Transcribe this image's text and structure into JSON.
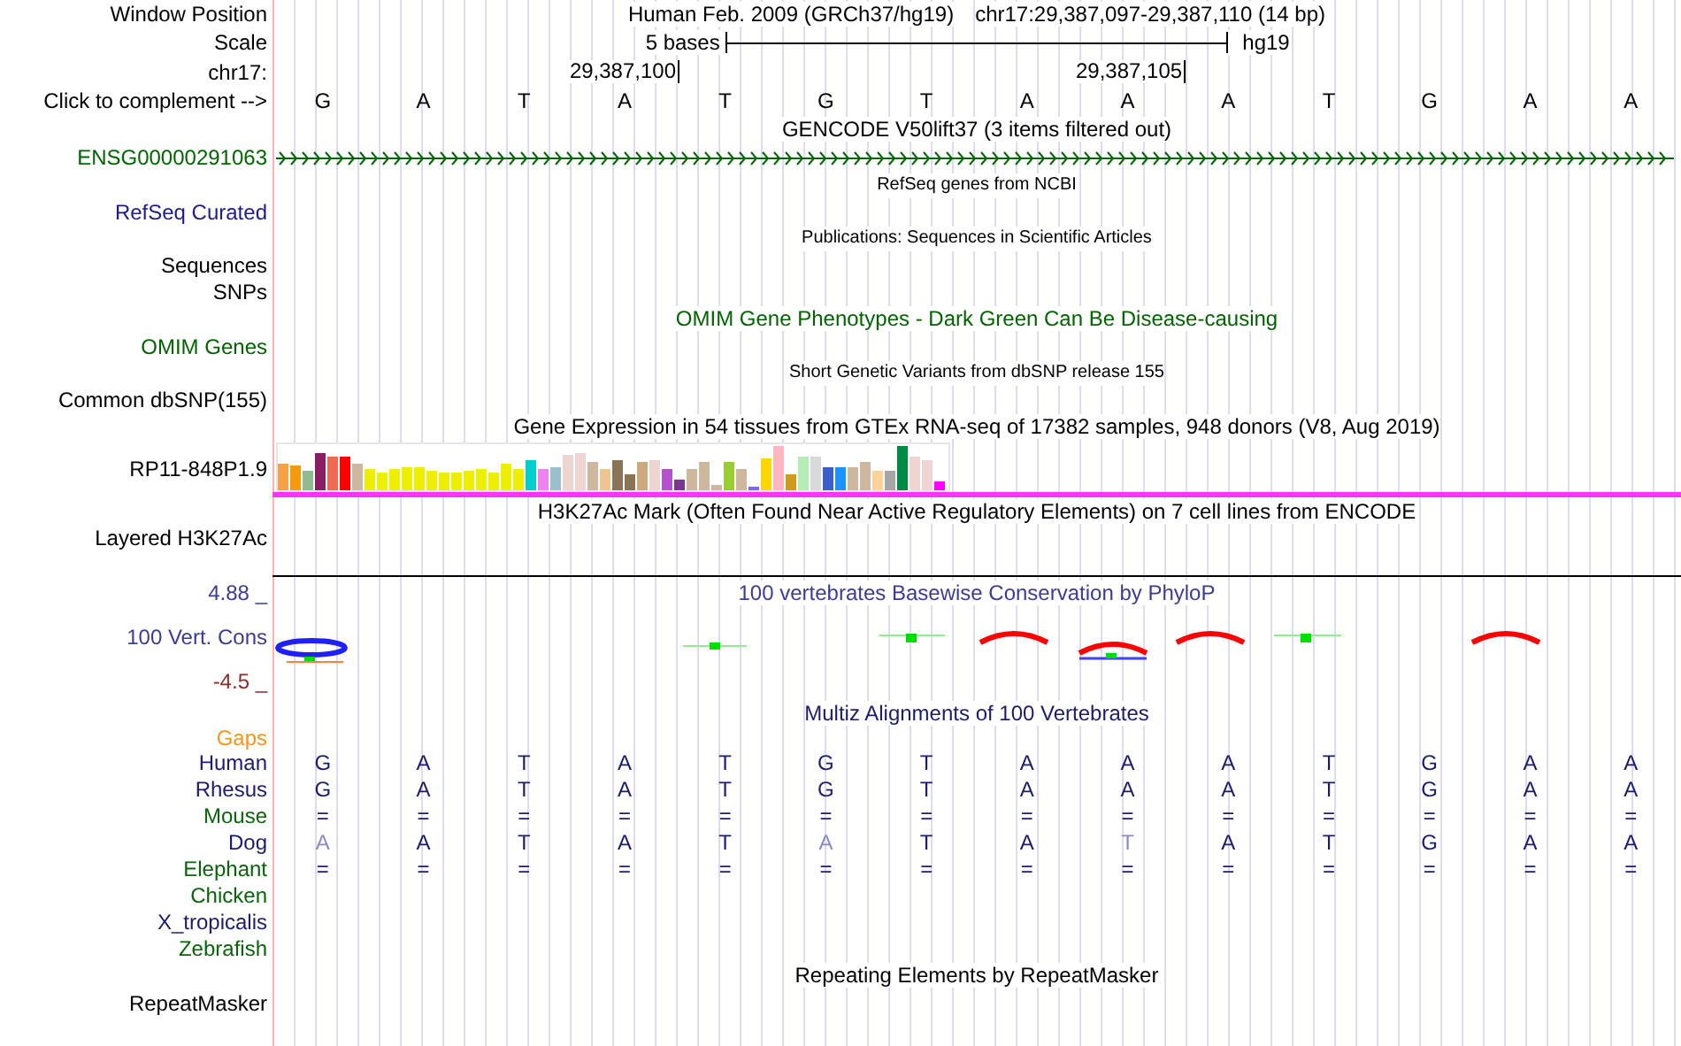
{
  "header": {
    "label": "Window Position",
    "assembly": "Human Feb. 2009 (GRCh37/hg19)",
    "position": "chr17:29,387,097-29,387,110 (14 bp)"
  },
  "scale": {
    "label": "Scale",
    "span": "5 bases",
    "assembly": "hg19"
  },
  "coordinates": {
    "label": "chr17:"
  },
  "sequence": {
    "label": "Click to complement -->",
    "bases": [
      {
        "base": "G"
      },
      {
        "base": "A"
      },
      {
        "base": "T"
      },
      {
        "base": "A",
        "coordinate": "29,387,100"
      },
      {
        "base": "T"
      },
      {
        "base": "G"
      },
      {
        "base": "T"
      },
      {
        "base": "A"
      },
      {
        "base": "A",
        "coordinate": "29,387,105"
      },
      {
        "base": "A"
      },
      {
        "base": "T"
      },
      {
        "base": "G"
      },
      {
        "base": "A"
      },
      {
        "base": "A"
      }
    ]
  },
  "tracks": [
    {
      "kind": "gene",
      "title": {
        "text": "GENCODE V50lift37 (3 items filtered out)",
        "color": "#000000"
      },
      "labels": [
        {
          "text": "ENSG00000291063",
          "color": "#006400"
        }
      ]
    },
    {
      "kind": "compact",
      "title": {
        "text": "RefSeq genes from NCBI",
        "color": "#000000"
      },
      "labels": [
        {
          "text": "RefSeq Curated",
          "color": "#1c1c8c"
        }
      ]
    },
    {
      "kind": "compact",
      "title": {
        "text": "Publications: Sequences in Scientific Articles",
        "color": "#000000"
      },
      "labels": [
        {
          "text": "Sequences",
          "color": "#000000"
        },
        {
          "text": "SNPs",
          "color": "#000000"
        }
      ]
    },
    {
      "kind": "empty",
      "title": {
        "text": "OMIM Gene Phenotypes - Dark Green Can Be Disease-causing",
        "color": "#006400"
      },
      "labels": [
        {
          "text": "OMIM Genes",
          "color": "#006400"
        }
      ]
    },
    {
      "kind": "compact",
      "title": {
        "text": "Short Genetic Variants from dbSNP release 155",
        "color": "#000000"
      },
      "labels": [
        {
          "text": "Common dbSNP(155)",
          "color": "#000000"
        }
      ]
    },
    {
      "kind": "expression",
      "title": {
        "text": "Gene Expression in 54 tissues from GTEx RNA-seq of 17382 samples, 948 donors (V8, Aug 2019)",
        "color": "#000000"
      },
      "labels": [
        {
          "text": "RP11-848P1.9",
          "color": "#000000"
        }
      ]
    },
    {
      "kind": "signal",
      "title": {
        "text": "H3K27Ac Mark (Often Found Near Active Regulatory Elements) on 7 cell lines from ENCODE",
        "color": "#000000"
      },
      "labels": [
        {
          "text": "Layered H3K27Ac",
          "color": "#000000"
        }
      ]
    },
    {
      "kind": "conservation",
      "title": {
        "text": "100 vertebrates Basewise Conservation by PhyloP",
        "color": "#3c3c96"
      },
      "labels": [
        {
          "text": "4.88 _",
          "color": "#3c3c96"
        },
        {
          "text": "100 Vert. Cons",
          "color": "#3c3c96"
        },
        {
          "text": "-4.5 _",
          "color": "#8b2c2c"
        }
      ]
    },
    {
      "kind": "alignment",
      "title": {
        "text": "Multiz Alignments of 100 Vertebrates",
        "color": "#1c1c6e"
      },
      "labels": [
        {
          "text": "Gaps",
          "color": "#f7941d"
        }
      ],
      "species": [
        {
          "name": "Human",
          "color": "#1c1c6e",
          "bases": [
            "G",
            "A",
            "T",
            "A",
            "T",
            "G",
            "T",
            "A",
            "A",
            "A",
            "T",
            "G",
            "A",
            "A"
          ]
        },
        {
          "name": "Rhesus",
          "color": "#1c1c6e",
          "bases": [
            "G",
            "A",
            "T",
            "A",
            "T",
            "G",
            "T",
            "A",
            "A",
            "A",
            "T",
            "G",
            "A",
            "A"
          ]
        },
        {
          "name": "Mouse",
          "color": "#0a640a",
          "bases": [
            "=",
            "=",
            "=",
            "=",
            "=",
            "=",
            "=",
            "=",
            "=",
            "=",
            "=",
            "=",
            "=",
            "="
          ]
        },
        {
          "name": "Dog",
          "color": "#1c1c6e",
          "bases": [
            "A",
            "A",
            "T",
            "A",
            "T",
            "A",
            "T",
            "A",
            "T",
            "A",
            "T",
            "G",
            "A",
            "A"
          ],
          "faded": [
            true,
            false,
            false,
            false,
            false,
            true,
            false,
            false,
            true,
            false,
            false,
            false,
            false,
            false
          ]
        },
        {
          "name": "Elephant",
          "color": "#0a640a",
          "bases": [
            "=",
            "=",
            "=",
            "=",
            "=",
            "=",
            "=",
            "=",
            "=",
            "=",
            "=",
            "=",
            "=",
            "="
          ]
        },
        {
          "name": "Chicken",
          "color": "#0a640a"
        },
        {
          "name": "X_tropicalis",
          "color": "#1c1c6e"
        },
        {
          "name": "Zebrafish",
          "color": "#0a640a"
        }
      ]
    },
    {
      "kind": "empty",
      "title": {
        "text": "Repeating Elements by RepeatMasker",
        "color": "#000000"
      },
      "labels": [
        {
          "text": "RepeatMasker",
          "color": "#000000"
        }
      ]
    }
  ]
}
